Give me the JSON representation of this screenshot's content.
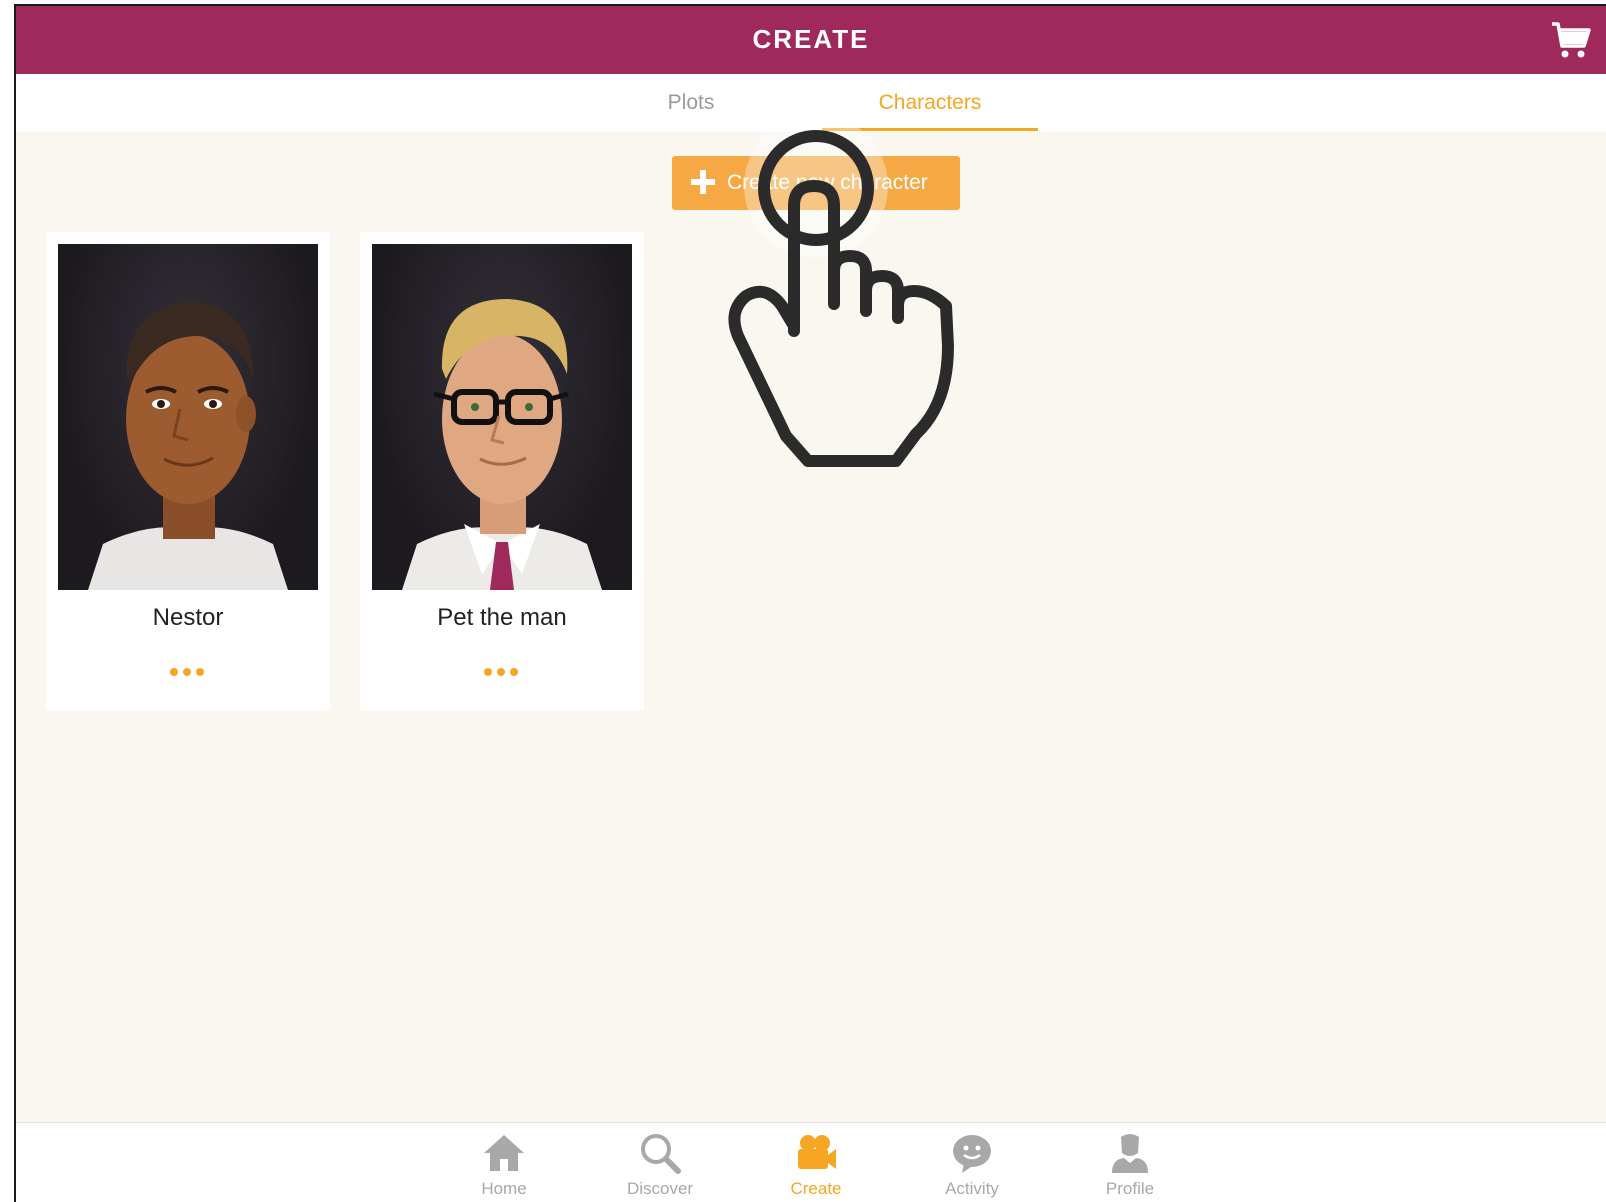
{
  "header": {
    "title": "CREATE",
    "cart_icon": "cart-icon"
  },
  "tabs": [
    {
      "label": "Plots",
      "active": false
    },
    {
      "label": "Characters",
      "active": true
    }
  ],
  "actions": {
    "create_label": "Create new character",
    "create_icon": "plus-icon"
  },
  "characters": [
    {
      "name": "Nestor",
      "menu_icon": "more-dots-icon"
    },
    {
      "name": "Pet the man",
      "menu_icon": "more-dots-icon"
    }
  ],
  "overlay": {
    "icon": "tap-hand-icon"
  },
  "bottom_nav": [
    {
      "label": "Home",
      "icon": "home-icon",
      "active": false
    },
    {
      "label": "Discover",
      "icon": "search-icon",
      "active": false
    },
    {
      "label": "Create",
      "icon": "camera-icon",
      "active": true
    },
    {
      "label": "Activity",
      "icon": "chat-bubble-icon",
      "active": false
    },
    {
      "label": "Profile",
      "icon": "profile-icon",
      "active": false
    }
  ],
  "colors": {
    "header_bg": "#a0295c",
    "accent": "#f5a623",
    "page_bg": "#faf7f0",
    "inactive": "#a8a8a8"
  }
}
